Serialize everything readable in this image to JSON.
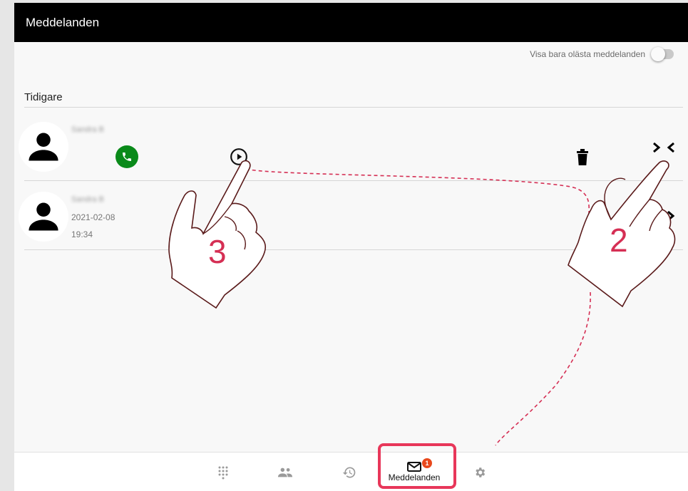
{
  "header": {
    "title": "Meddelanden"
  },
  "filter": {
    "label": "Visa bara olästa meddelanden",
    "enabled": false
  },
  "section": {
    "title": "Tidigare"
  },
  "messages": [
    {
      "name": "Sandra B",
      "date": "",
      "time": "",
      "expanded": true
    },
    {
      "name": "Sandra B",
      "date": "2021-02-08",
      "time": "19:34",
      "expanded": false
    }
  ],
  "bottom_nav": {
    "items": [
      {
        "icon": "dialpad-icon"
      },
      {
        "icon": "contacts-icon"
      },
      {
        "icon": "history-icon"
      },
      {
        "icon": "mail-icon",
        "label": "Meddelanden",
        "badge": "1",
        "active": true
      },
      {
        "icon": "gear-icon"
      }
    ]
  },
  "annotations": {
    "step2": "2",
    "step3": "3",
    "accent_color": "#d52f54"
  }
}
